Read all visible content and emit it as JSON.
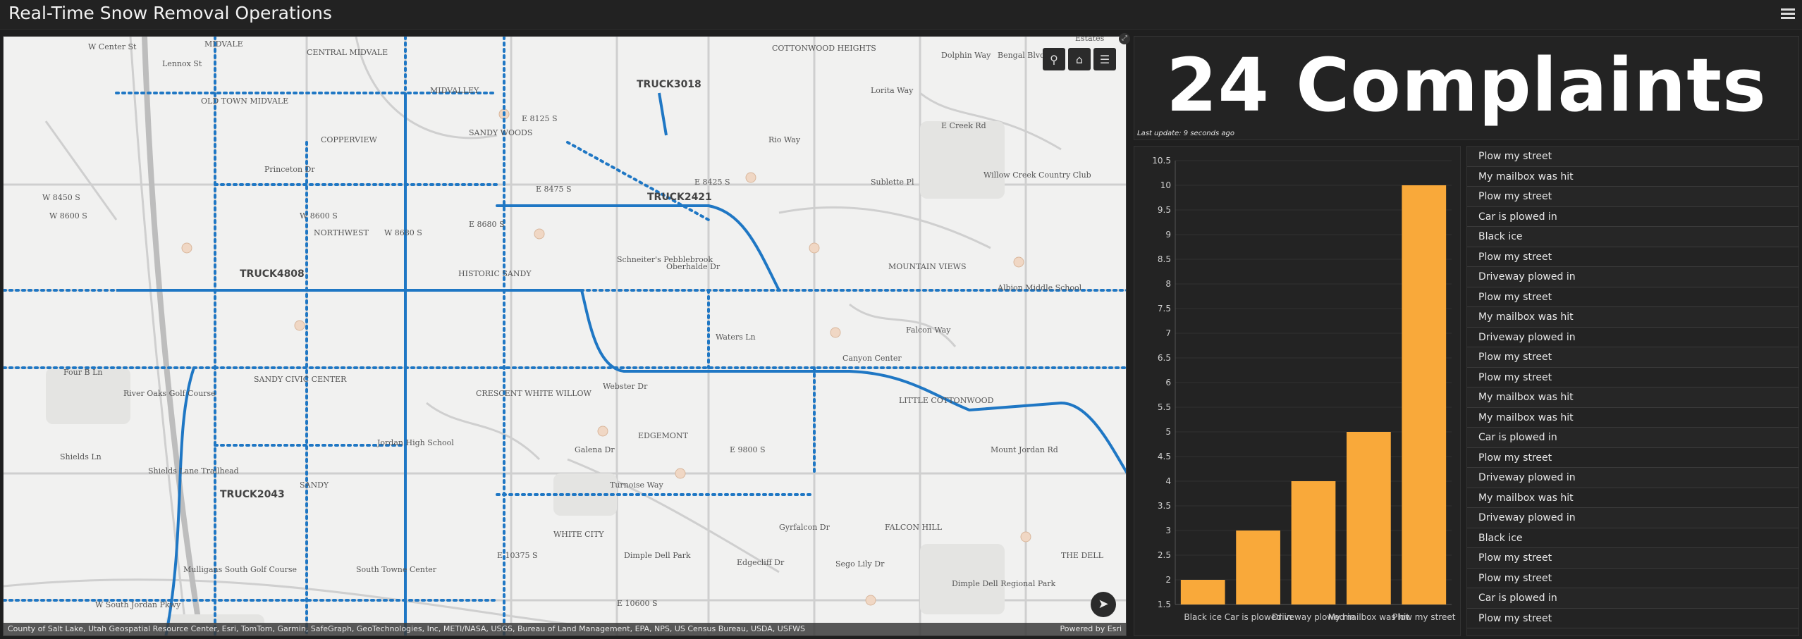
{
  "header": {
    "title": "Real-Time Snow Removal Operations",
    "menu_icon": "hamburger-menu-icon"
  },
  "map": {
    "labels": [
      {
        "t": "W Center St"
      },
      {
        "t": "MIDVALE"
      },
      {
        "t": "CENTRAL MIDVALE"
      },
      {
        "t": "Lennox St"
      },
      {
        "t": "MIDVALLEY"
      },
      {
        "t": "OLD TOWN MIDVALE"
      },
      {
        "t": "COPPERVIEW"
      },
      {
        "t": "SANDY WOODS"
      },
      {
        "t": "Princeton Dr"
      },
      {
        "t": "W 8450 S"
      },
      {
        "t": "W 8600 S"
      },
      {
        "t": "W 8600 S"
      },
      {
        "t": "NORTHWEST"
      },
      {
        "t": "W 8680 S"
      },
      {
        "t": "E 8680 S"
      },
      {
        "t": "HISTORIC SANDY"
      },
      {
        "t": "Schneiter's Pebblebrook"
      },
      {
        "t": "E 8125 S"
      },
      {
        "t": "E 8475 S"
      },
      {
        "t": "E 8425 S"
      },
      {
        "t": "Sublette Pl"
      },
      {
        "t": "Willow Creek Country Club"
      },
      {
        "t": "MOUNTAIN VIEWS"
      },
      {
        "t": "Albion Middle School"
      },
      {
        "t": "Falcon Way"
      },
      {
        "t": "Canyon Center"
      },
      {
        "t": "Four B Ln"
      },
      {
        "t": "River Oaks Golf Course"
      },
      {
        "t": "SANDY CIVIC CENTER"
      },
      {
        "t": "CRESCENT WHITE WILLOW"
      },
      {
        "t": "Webster Dr"
      },
      {
        "t": "LITTLE COTTONWOOD"
      },
      {
        "t": "Jordan High School"
      },
      {
        "t": "EDGEMONT"
      },
      {
        "t": "E 9800 S"
      },
      {
        "t": "Mount Jordan Rd"
      },
      {
        "t": "Shields Ln"
      },
      {
        "t": "Shields Lane Trailhead"
      },
      {
        "t": "SANDY"
      },
      {
        "t": "Galena Dr"
      },
      {
        "t": "Turnoise Way"
      },
      {
        "t": "Gyrfalcon Dr"
      },
      {
        "t": "FALCON HILL"
      },
      {
        "t": "WHITE CITY"
      },
      {
        "t": "Dimple Dell Park"
      },
      {
        "t": "Edgecliff Dr"
      },
      {
        "t": "Sego Lily Dr"
      },
      {
        "t": "Dimple Dell Regional Park"
      },
      {
        "t": "Mulligans South Golf Course"
      },
      {
        "t": "South Towne Center"
      },
      {
        "t": "W South Jordan Pkwy"
      },
      {
        "t": "E 10600 S"
      },
      {
        "t": "THE DELL"
      },
      {
        "t": "Bengal Blvd"
      },
      {
        "t": "Dolphin Way"
      },
      {
        "t": "Lorita Way"
      },
      {
        "t": "E Creek Rd"
      },
      {
        "t": "Rio Way"
      },
      {
        "t": "COTTONWOOD HEIGHTS"
      },
      {
        "t": "Estates"
      },
      {
        "t": "Waters Ln"
      },
      {
        "t": "E 10375 S"
      },
      {
        "t": "Oberhalde Dr"
      }
    ],
    "trucks": [
      {
        "t": "TRUCK3018"
      },
      {
        "t": "TRUCK2421"
      },
      {
        "t": "TRUCK4808"
      },
      {
        "t": "TRUCK2043"
      }
    ],
    "widgets": [
      "search-icon",
      "home-icon",
      "legend-list-icon"
    ],
    "attribution": "County of Salt Lake, Utah Geospatial Resource Center, Esri, TomTom, Garmin, SafeGraph, GeoTechnologies, Inc, METI/NASA, USGS, Bureau of Land Management, EPA, NPS, US Census Bureau, USDA, USFWS",
    "powered_by": "Powered by Esri"
  },
  "indicator": {
    "value_text": "24 Complaints",
    "last_update": "Last update: 9 seconds ago"
  },
  "chart_data": {
    "type": "bar",
    "categories": [
      "Black ice",
      "Car is plowed in",
      "Driveway plowed in",
      "My mailbox was hit",
      "Plow my street"
    ],
    "values": [
      2,
      3,
      4,
      5,
      10
    ],
    "ylim": [
      1.5,
      10.5
    ],
    "yticks": [
      "10.5",
      "10",
      "9.5",
      "9",
      "8.5",
      "8",
      "7.5",
      "7",
      "6.5",
      "6",
      "5.5",
      "5",
      "4.5",
      "4",
      "3.5",
      "3",
      "2.5",
      "2",
      "1.5"
    ],
    "color": "#f9a93a",
    "grid": true
  },
  "complaints": [
    "Plow my street",
    "My mailbox was hit",
    "Plow my street",
    "Car is plowed in",
    "Black ice",
    "Plow my street",
    "Driveway plowed in",
    "Plow my street",
    "My mailbox was hit",
    "Driveway plowed in",
    "Plow my street",
    "Plow my street",
    "My mailbox was hit",
    "My mailbox was hit",
    "Car is plowed in",
    "Plow my street",
    "Driveway plowed in",
    "My mailbox was hit",
    "Driveway plowed in",
    "Black ice",
    "Plow my street",
    "Plow my street",
    "Car is plowed in",
    "Plow my street"
  ]
}
